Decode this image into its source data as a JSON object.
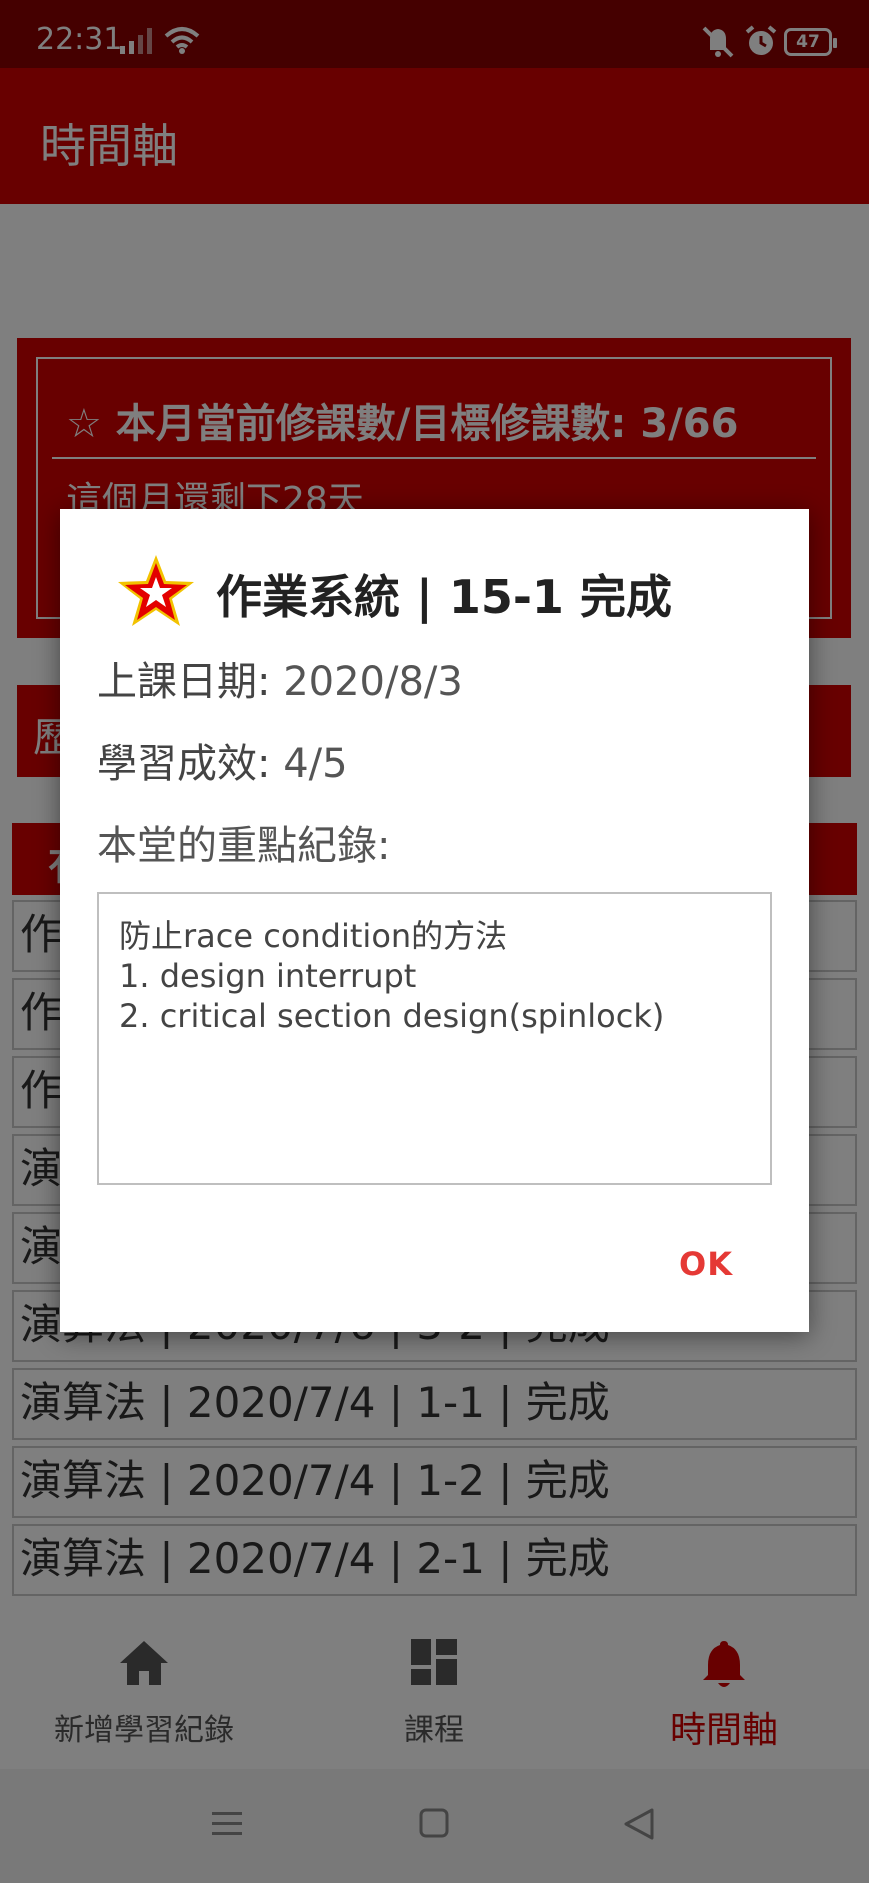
{
  "status_bar": {
    "time": "22:31",
    "battery": "47"
  },
  "app_bar": {
    "title": "時間軸"
  },
  "summary": {
    "heading": "☆ 本月當前修課數/目標修課數:  3/66",
    "remaining": "這個月還剩下28天"
  },
  "history": {
    "label": "歷"
  },
  "course_list": {
    "header": "有",
    "rows": [
      "作",
      "作",
      "作",
      "演",
      "演",
      "演算法 |  2020/7/6  |  3-2  |  完成",
      "演算法 |  2020/7/4  |  1-1  |  完成",
      "演算法 |  2020/7/4  |  1-2  |  完成",
      "演算法 |  2020/7/4  |  2-1  |  完成"
    ]
  },
  "dialog": {
    "icon": "red-star-icon",
    "title": "作業系統 |  15-1  完成",
    "date_label": "上課日期:",
    "date_value": "2020/8/3",
    "score_label": "學習成效:",
    "score_value": "4/5",
    "notes_label": "本堂的重點紀錄:",
    "notes": "防止race condition的方法\n1. design interrupt\n2. critical section design(spinlock)",
    "ok": "OK"
  },
  "bottom_nav": {
    "items": [
      {
        "label": "新增學習紀錄",
        "icon": "home-icon",
        "active": false
      },
      {
        "label": "課程",
        "icon": "dashboard-icon",
        "active": false
      },
      {
        "label": "時間軸",
        "icon": "bell-icon",
        "active": true
      }
    ]
  },
  "colors": {
    "primary": "#d10000",
    "status_bar": "#8a0000",
    "accent": "#e53935"
  }
}
